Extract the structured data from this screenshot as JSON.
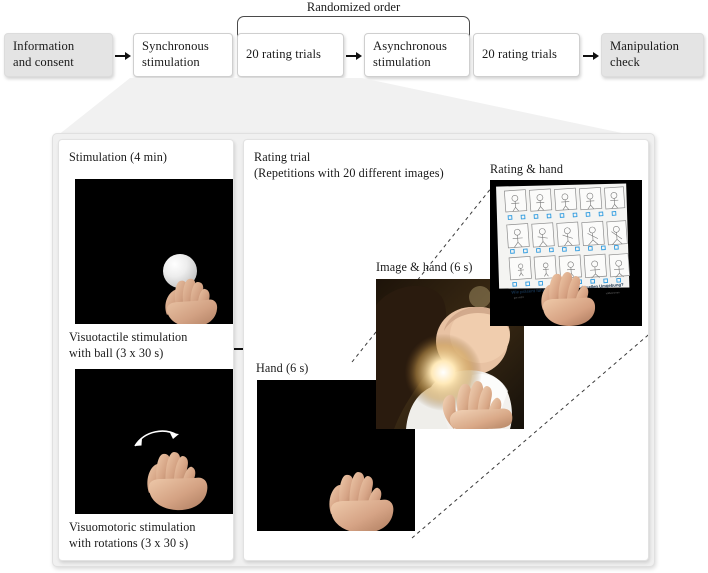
{
  "figure": {
    "top_flow": {
      "bracket_label": "Randomized order",
      "steps": [
        {
          "id": "information-and-consent",
          "label": "Information\nand consent",
          "style": "grey"
        },
        {
          "id": "synchronous-stimulation",
          "label": "Synchronous\nstimulation",
          "style": "white"
        },
        {
          "id": "rating-trials-1",
          "label": "20 rating trials",
          "style": "white"
        },
        {
          "id": "asynchronous-stimulation",
          "label": "Asynchronous\nstimulation",
          "style": "white"
        },
        {
          "id": "rating-trials-2",
          "label": "20 rating trials",
          "style": "white"
        },
        {
          "id": "manipulation-check",
          "label": "Manipulation\ncheck",
          "style": "grey"
        }
      ]
    },
    "detail": {
      "stimulation_panel": {
        "title": "Stimulation (4 min)",
        "caption_top": "Visuotactile stimulation\nwith ball (3 x 30 s)",
        "caption_bottom": "Visuomotoric stimulation\nwith rotations (3 x 30 s)"
      },
      "rating_panel": {
        "title": "Rating trial\n(Repetitions with 20 different images)",
        "stage_hand": "Hand (6 s)",
        "stage_image": "Image & hand (6 s)",
        "stage_rating": "Rating & hand"
      },
      "rating_sheet": {
        "question": "Wie präsent fühlen Sie sich in der virtuellen Umgebung?",
        "anchor_left": "gar nicht",
        "anchor_right": "vollkommen",
        "checkbox_color": "#2e9be0"
      }
    },
    "colors": {
      "box_grey": "#e4e4e4",
      "box_white": "#ffffff",
      "panel_grey": "#f0f0f0",
      "scene_black": "#000000",
      "outline": "#cfcfcf",
      "text": "#1a1a1a"
    }
  }
}
